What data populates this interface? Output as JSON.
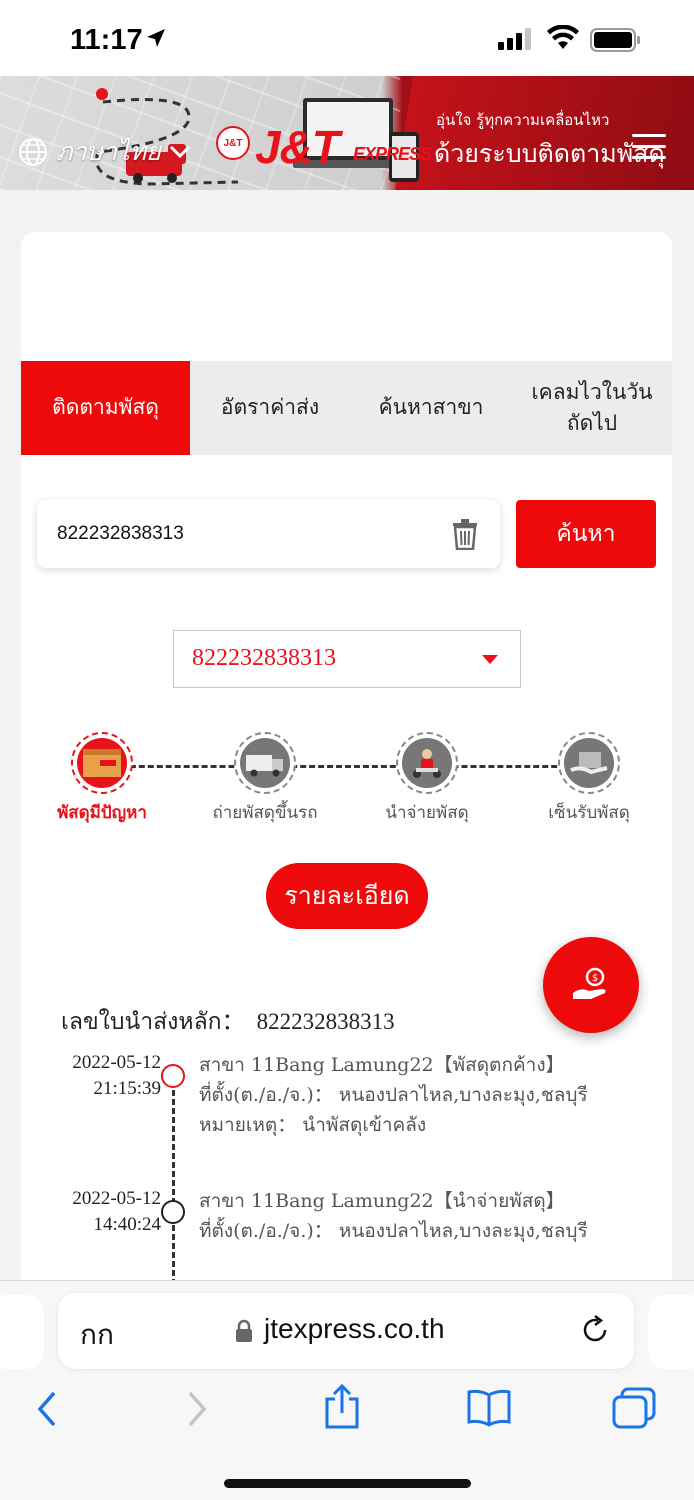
{
  "status_bar": {
    "time": "11:17"
  },
  "header": {
    "language": "ภาษาไทย",
    "logo": "J&T",
    "logo_sub": "EXPRESS",
    "tagline_1": "อุ่นใจ รู้ทุกความเคลื่อนไหว",
    "tagline_2": "ด้วยระบบติดตามพัสดุ"
  },
  "tabs": [
    {
      "label": "ติดตามพัสดุ",
      "active": true
    },
    {
      "label": "อัตราค่าส่ง",
      "active": false
    },
    {
      "label": "ค้นหาสาขา",
      "active": false
    },
    {
      "label": "เคลมไวในวันถัดไป",
      "active": false
    }
  ],
  "search": {
    "value": "822232838313",
    "button_label": "ค้นหา"
  },
  "selected_tracking": "822232838313",
  "steps": [
    {
      "label": "พัสดุมีปัญหา",
      "active": true
    },
    {
      "label": "ถ่ายพัสดุขึ้นรถ",
      "active": false
    },
    {
      "label": "นำจ่ายพัสดุ",
      "active": false
    },
    {
      "label": "เซ็นรับพัสดุ",
      "active": false
    }
  ],
  "detail_button": "รายละเอียด",
  "main_waybill": {
    "label": "เลขใบนำส่งหลัก：",
    "value": "822232838313"
  },
  "events": [
    {
      "date": "2022-05-12",
      "time": "21:15:39",
      "line1": "สาขา 11Bang Lamung22【พัสดุตกค้าง】",
      "line2": "ที่ตั้ง(ต./อ./จ.)： หนองปลาไหล,บางละมุง,ชลบุรี",
      "line3": "หมายเหตุ： นำพัสดุเข้าคลัง"
    },
    {
      "date": "2022-05-12",
      "time": "14:40:24",
      "line1": "สาขา 11Bang Lamung22【นำจ่ายพัสดุ】",
      "line2": "ที่ตั้ง(ต./อ./จ.)： หนองปลาไหล,บางละมุง,ชลบุรี",
      "line3": ""
    }
  ],
  "browser": {
    "aa": "กก",
    "url": "jtexpress.co.th"
  },
  "colors": {
    "brand_red": "#ee0a0a",
    "text_red": "#e8121b",
    "ios_blue": "#1a73e8"
  }
}
